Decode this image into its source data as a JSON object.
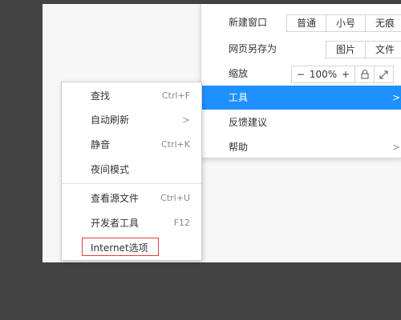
{
  "browser_menu": {
    "new_window": {
      "label": "新建窗口",
      "options": [
        "普通",
        "小号",
        "无痕"
      ]
    },
    "save_as": {
      "label": "网页另存为",
      "options": [
        "图片",
        "文件"
      ]
    },
    "zoom": {
      "label": "缩放",
      "minus": "−",
      "value": "100%",
      "plus": "+"
    },
    "tools": {
      "label": "工具"
    },
    "feedback": {
      "label": "反馈建议"
    },
    "help": {
      "label": "帮助"
    }
  },
  "context_menu": {
    "find": {
      "label": "查找",
      "shortcut": "Ctrl+F"
    },
    "auto_refresh": {
      "label": "自动刷新"
    },
    "mute": {
      "label": "静音",
      "shortcut": "Ctrl+K"
    },
    "night_mode": {
      "label": "夜间模式"
    },
    "view_source": {
      "label": "查看源文件",
      "shortcut": "Ctrl+U"
    },
    "dev_tools": {
      "label": "开发者工具",
      "shortcut": "F12"
    },
    "internet_options": {
      "label": "Internet选项"
    }
  },
  "colors": {
    "highlight": "#1e90ff",
    "annotation": "#e04040",
    "background": "#434343"
  }
}
